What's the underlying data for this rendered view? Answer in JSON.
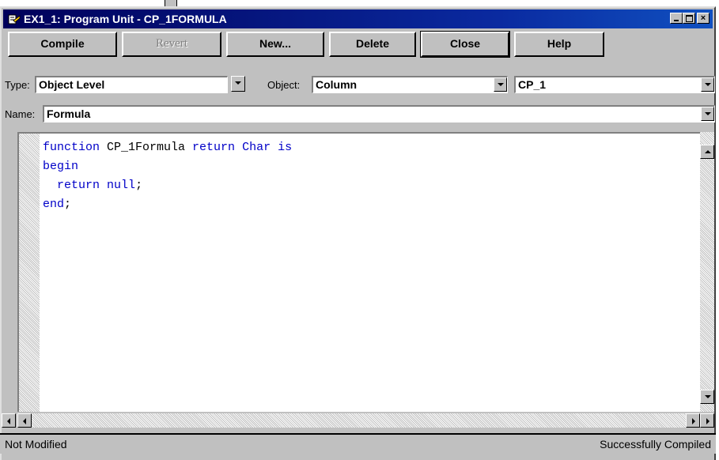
{
  "window": {
    "title": "EX1_1: Program Unit - CP_1FORMULA"
  },
  "toolbar": {
    "compile": "Compile",
    "revert": "Revert",
    "new": "New...",
    "delete": "Delete",
    "close": "Close",
    "help": "Help"
  },
  "fields": {
    "type_label": "Type:",
    "type_value": "Object Level",
    "object_label": "Object:",
    "object_value": "Column",
    "object_name_value": "CP_1",
    "name_label": "Name:",
    "name_value": "Formula"
  },
  "code": {
    "lines": [
      [
        {
          "t": "function",
          "k": true
        },
        {
          "t": " CP_1Formula ",
          "k": false
        },
        {
          "t": "return",
          "k": true
        },
        {
          "t": " ",
          "k": false
        },
        {
          "t": "Char",
          "k": true
        },
        {
          "t": " ",
          "k": false
        },
        {
          "t": "is",
          "k": true
        }
      ],
      [
        {
          "t": "begin",
          "k": true
        }
      ],
      [
        {
          "t": "  ",
          "k": false
        },
        {
          "t": "return",
          "k": true
        },
        {
          "t": " ",
          "k": false
        },
        {
          "t": "null",
          "k": true
        },
        {
          "t": ";",
          "k": false
        }
      ],
      [
        {
          "t": "end",
          "k": true
        },
        {
          "t": ";",
          "k": false
        }
      ]
    ]
  },
  "status": {
    "left": "Not Modified",
    "right": "Successfully Compiled"
  },
  "colors": {
    "keyword": "#0000c8",
    "titlebar": "#00005a"
  },
  "icons": [
    "program-unit-icon",
    "minimize-icon",
    "maximize-icon",
    "close-icon",
    "chevron-down-icon",
    "arrow-up-icon",
    "arrow-down-icon",
    "arrow-left-icon",
    "arrow-right-icon"
  ]
}
